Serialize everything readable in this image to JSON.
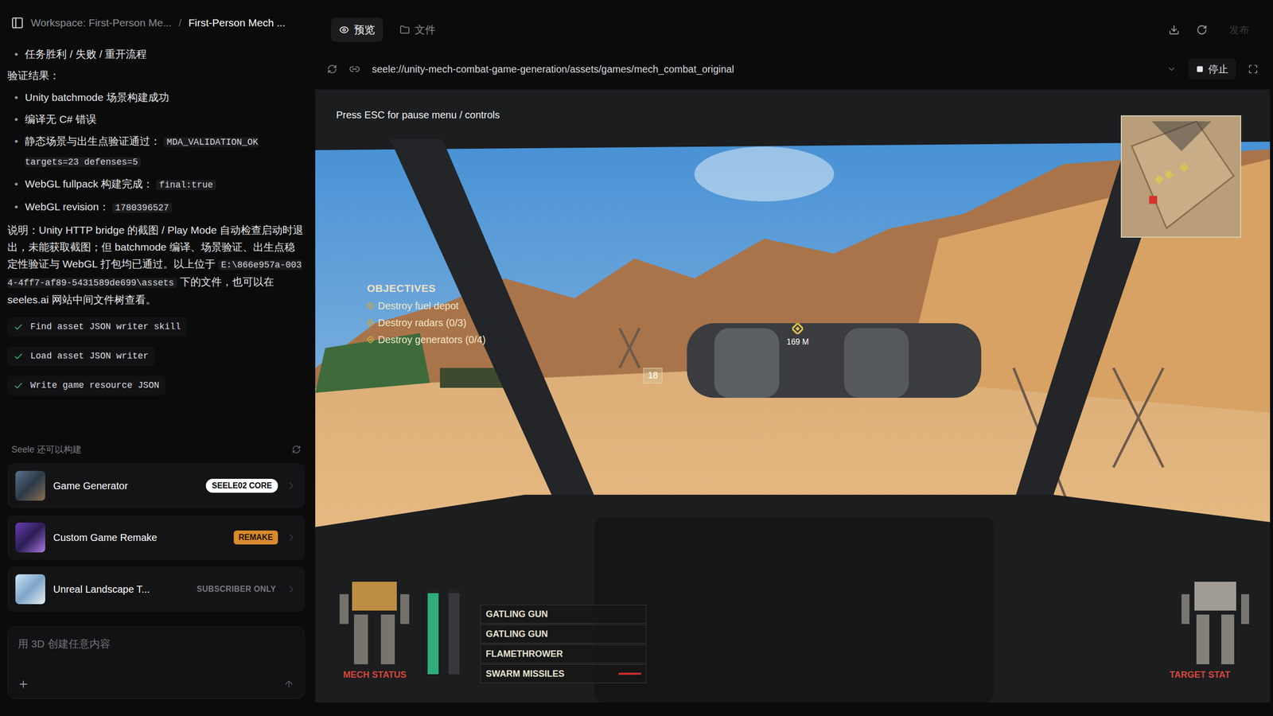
{
  "breadcrumb": {
    "workspace": "Workspace: First-Person Me...",
    "separator": "/",
    "project": "First-Person Mech ..."
  },
  "chat": {
    "top_bullets": [
      "任务胜利 / 失败 / 重开流程"
    ],
    "heading": "验证结果：",
    "results": [
      {
        "text": "Unity batchmode 场景构建成功",
        "code": ""
      },
      {
        "text": "编译无 C# 错误",
        "code": ""
      },
      {
        "text": "静态场景与出生点验证通过：",
        "code": "MDA_VALIDATION_OK targets=23 defenses=5"
      },
      {
        "text": "WebGL fullpack 构建完成：",
        "code": "final:true"
      },
      {
        "text": "WebGL revision：",
        "code": "1780396527"
      }
    ],
    "note_before": "说明：Unity HTTP bridge 的截图 / Play Mode 自动检查启动时退出，未能获取截图；但 batchmode 编译、场景验证、出生点稳定性验证与 WebGL 打包均已通过。以上位于 ",
    "note_code": "E:\\866e957a-0034-4ff7-af89-5431589de699\\assets",
    "note_after": " 下的文件，也可以在 seeles.ai 网站中间文件树查看。",
    "steps": [
      {
        "label": "Find asset JSON writer skill",
        "done": true
      },
      {
        "label": "Load asset JSON writer",
        "done": true
      },
      {
        "label": "Write game resource JSON",
        "done": true
      }
    ]
  },
  "suggestions": {
    "title": "Seele 还可以构建",
    "items": [
      {
        "name": "Game Generator",
        "badge": "SEELE02 CORE",
        "kind": "core"
      },
      {
        "name": "Custom Game Remake",
        "badge": "REMAKE",
        "kind": "remake"
      },
      {
        "name": "Unreal Landscape T...",
        "badge": "SUBSCRIBER ONLY",
        "kind": "locked"
      }
    ]
  },
  "composer": {
    "placeholder": "用 3D 创建任意内容"
  },
  "preview": {
    "tabs": [
      {
        "label": "预览",
        "selected": true
      },
      {
        "label": "文件",
        "selected": false
      }
    ],
    "publish": "发布",
    "url": "seele://unity-mech-combat-game-generation/assets/games/mech_combat_original",
    "stop": "停止"
  },
  "game": {
    "hint": "Press ESC for pause menu / controls",
    "objectives": {
      "title": "OBJECTIVES",
      "items": [
        "Destroy fuel depot",
        "Destroy radars (0/3)",
        "Destroy generators (0/4)"
      ]
    },
    "distance_marker": "169 M",
    "lead_marker": "18",
    "weapons": [
      {
        "name": "GATLING GUN",
        "alert": false
      },
      {
        "name": "GATLING GUN",
        "alert": false
      },
      {
        "name": "FLAMETHROWER",
        "alert": false
      },
      {
        "name": "SWARM MISSILES",
        "alert": true
      }
    ],
    "health_bars": [
      {
        "level": 0.95,
        "color": "#2fae7c"
      },
      {
        "level": 0.95,
        "color": "#35383a"
      }
    ],
    "mech_status": "MECH STATUS",
    "target_status": "TARGET STAT"
  }
}
